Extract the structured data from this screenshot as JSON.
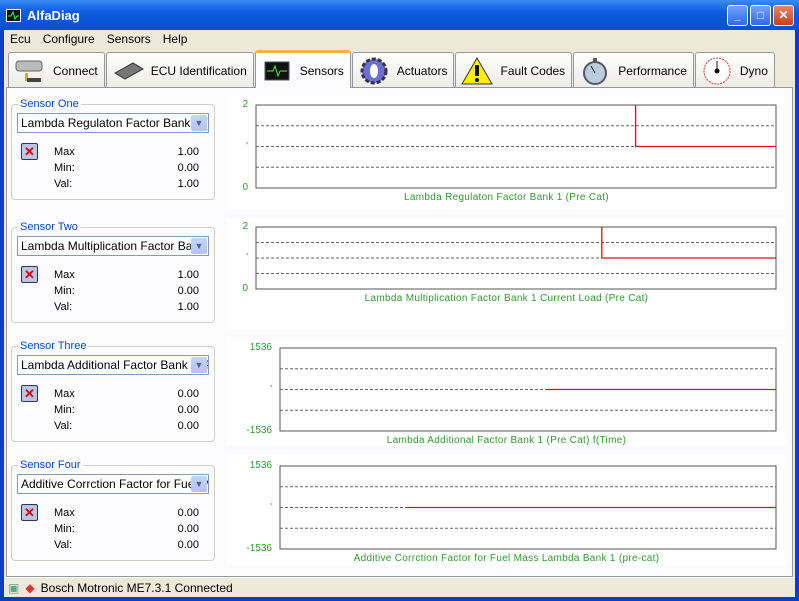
{
  "window": {
    "title": "AlfaDiag"
  },
  "menu": [
    "Ecu",
    "Configure",
    "Sensors",
    "Help"
  ],
  "tabs": [
    {
      "label": "Connect",
      "icon": "connect-icon"
    },
    {
      "label": "ECU Identification",
      "icon": "chip-icon"
    },
    {
      "label": "Sensors",
      "icon": "oscilloscope-icon",
      "active": true
    },
    {
      "label": "Actuators",
      "icon": "gear-icon"
    },
    {
      "label": "Fault Codes",
      "icon": "warning-icon"
    },
    {
      "label": "Performance",
      "icon": "stopwatch-icon"
    },
    {
      "label": "Dyno",
      "icon": "gauge-icon"
    }
  ],
  "sensors": [
    {
      "group": "Sensor One",
      "selected": "Lambda Regulaton Factor Bank 1 (Pre Cat)",
      "max_label": "Max",
      "min_label": "Min:",
      "val_label": "Val:",
      "max": "1.00",
      "min": "0.00",
      "val": "1.00"
    },
    {
      "group": "Sensor Two",
      "selected": "Lambda Multiplication Factor Bank 1 Current Load (Pre Cat)",
      "max_label": "Max",
      "min_label": "Min:",
      "val_label": "Val:",
      "max": "1.00",
      "min": "0.00",
      "val": "1.00"
    },
    {
      "group": "Sensor Three",
      "selected": "Lambda Additional Factor Bank 1 (Pre Cat) f(Time)",
      "max_label": "Max",
      "min_label": "Min:",
      "val_label": "Val:",
      "max": "0.00",
      "min": "0.00",
      "val": "0.00"
    },
    {
      "group": "Sensor Four",
      "selected": "Additive Corrction Factor for Fuel Mass Lambda Bank 1 (pre-cat)",
      "max_label": "Max",
      "min_label": "Min:",
      "val_label": "Val:",
      "max": "0.00",
      "min": "0.00",
      "val": "0.00"
    }
  ],
  "chart_data": [
    {
      "type": "line",
      "title": "Lambda Regulaton Factor Bank 1 (Pre Cat)",
      "ylim": [
        0,
        2
      ],
      "yticks": [
        "2",
        "'",
        "0"
      ],
      "x": [
        0.73,
        0.73,
        1
      ],
      "y": [
        2,
        1,
        1
      ],
      "color": "#e01010"
    },
    {
      "type": "line",
      "title": "Lambda Multiplication Factor Bank 1 Current Load (Pre Cat)",
      "ylim": [
        0,
        2
      ],
      "yticks": [
        "2",
        "'",
        "0"
      ],
      "x": [
        0.665,
        0.665,
        1
      ],
      "y": [
        2,
        1,
        1
      ],
      "color": "#e01010"
    },
    {
      "type": "line",
      "title": "Lambda Additional Factor Bank 1 (Pre Cat) f(Time)",
      "ylim": [
        -1536,
        1536
      ],
      "yticks": [
        "1536",
        "'",
        "-1536"
      ],
      "x": [
        0.54,
        1
      ],
      "y": [
        0,
        0
      ],
      "color": "#e01010"
    },
    {
      "type": "line",
      "title": "Additive Corrction Factor for Fuel Mass Lambda Bank 1 (pre-cat)",
      "ylim": [
        -1536,
        1536
      ],
      "yticks": [
        "1536",
        "'",
        "-1536"
      ],
      "x": [
        0.254,
        1
      ],
      "y": [
        0,
        0
      ],
      "color": "#e01010"
    }
  ],
  "status": {
    "text": "Bosch Motronic ME7.3.1 Connected"
  }
}
